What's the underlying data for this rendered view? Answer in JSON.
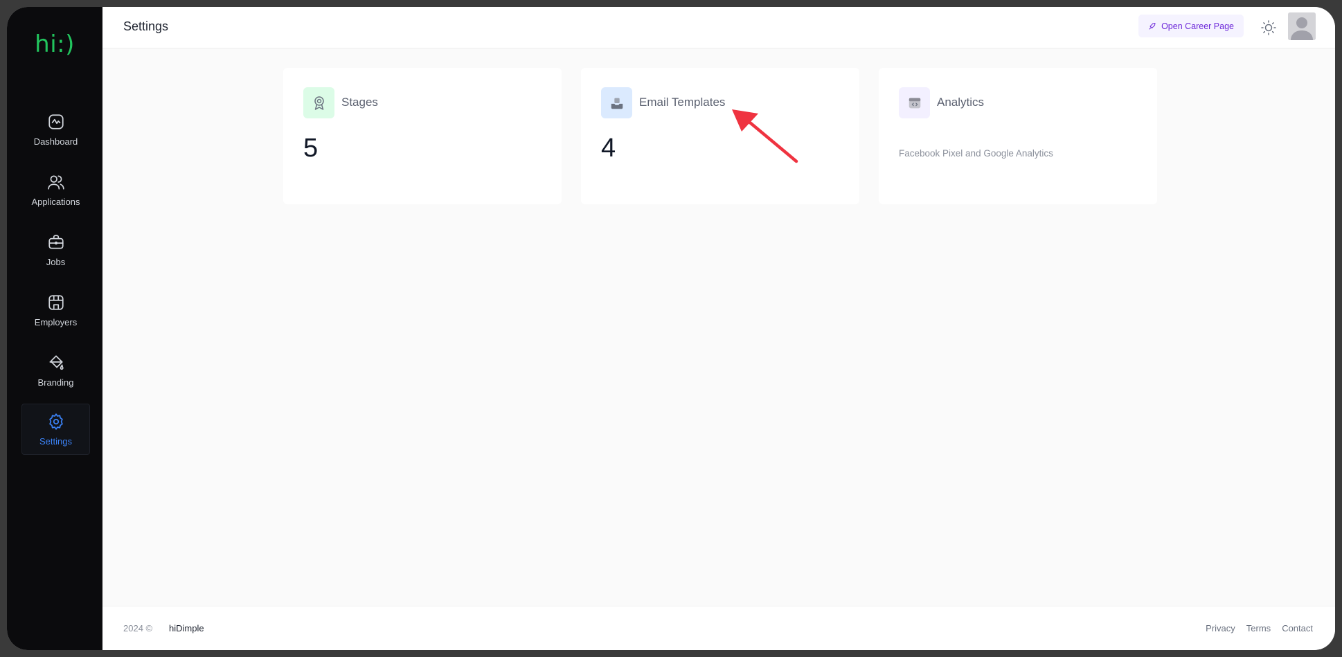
{
  "sidebar": {
    "logo": "hi:)",
    "items": [
      {
        "label": "Dashboard",
        "icon": "activity-icon"
      },
      {
        "label": "Applications",
        "icon": "users-icon"
      },
      {
        "label": "Jobs",
        "icon": "briefcase-icon"
      },
      {
        "label": "Employers",
        "icon": "store-icon"
      },
      {
        "label": "Branding",
        "icon": "paint-bucket-icon"
      },
      {
        "label": "Settings",
        "icon": "gear-icon",
        "active": true
      }
    ]
  },
  "header": {
    "title": "Settings",
    "career_button": "Open Career Page",
    "theme_icon": "sun-icon",
    "avatar_icon": "user-avatar"
  },
  "cards": [
    {
      "title": "Stages",
      "value": "5",
      "icon": "award-icon",
      "icon_bg": "#dcfce7"
    },
    {
      "title": "Email Templates",
      "value": "4",
      "icon": "inbox-icon",
      "icon_bg": "#dbeafe"
    },
    {
      "title": "Analytics",
      "description": "Facebook Pixel and Google Analytics",
      "icon": "code-window-icon",
      "icon_bg": "#f3f0ff"
    }
  ],
  "annotation": {
    "color": "#ef3340"
  },
  "footer": {
    "year": "2024 ©",
    "brand": "hiDimple",
    "links": [
      "Privacy",
      "Terms",
      "Contact"
    ]
  }
}
